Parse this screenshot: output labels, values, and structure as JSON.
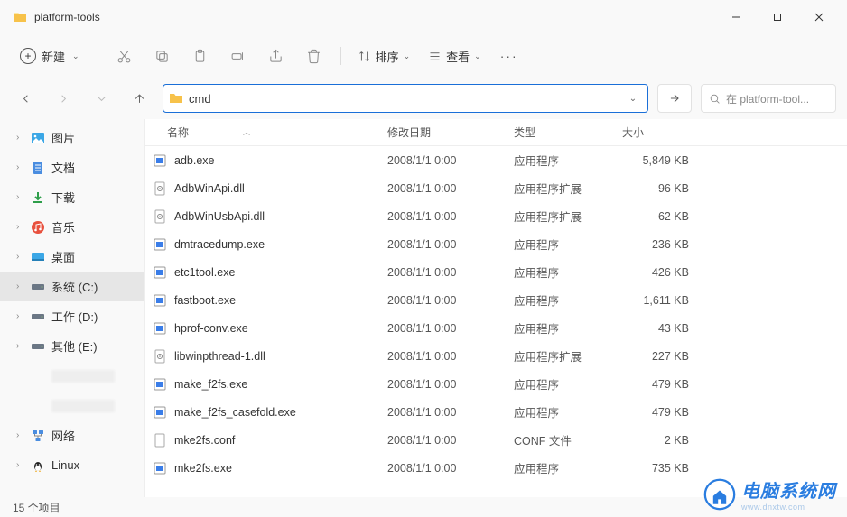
{
  "title": "platform-tools",
  "toolbar": {
    "new_label": "新建",
    "sort_label": "排序",
    "view_label": "查看"
  },
  "address": {
    "value": "cmd"
  },
  "search": {
    "placeholder": "在 platform-tool..."
  },
  "sidebar": {
    "items": [
      {
        "label": "图片",
        "icon": "pictures"
      },
      {
        "label": "文档",
        "icon": "docs"
      },
      {
        "label": "下载",
        "icon": "downloads"
      },
      {
        "label": "音乐",
        "icon": "music"
      },
      {
        "label": "桌面",
        "icon": "desktop"
      },
      {
        "label": "系统 (C:)",
        "icon": "drive",
        "selected": true
      },
      {
        "label": "工作 (D:)",
        "icon": "drive"
      },
      {
        "label": "其他 (E:)",
        "icon": "drive"
      },
      {
        "label": "网络",
        "icon": "network"
      },
      {
        "label": "Linux",
        "icon": "linux"
      }
    ]
  },
  "columns": {
    "name": "名称",
    "date": "修改日期",
    "type": "类型",
    "size": "大小"
  },
  "files": [
    {
      "name": "adb.exe",
      "date": "2008/1/1 0:00",
      "type": "应用程序",
      "size": "5,849 KB",
      "icon": "exe"
    },
    {
      "name": "AdbWinApi.dll",
      "date": "2008/1/1 0:00",
      "type": "应用程序扩展",
      "size": "96 KB",
      "icon": "dll"
    },
    {
      "name": "AdbWinUsbApi.dll",
      "date": "2008/1/1 0:00",
      "type": "应用程序扩展",
      "size": "62 KB",
      "icon": "dll"
    },
    {
      "name": "dmtracedump.exe",
      "date": "2008/1/1 0:00",
      "type": "应用程序",
      "size": "236 KB",
      "icon": "exe"
    },
    {
      "name": "etc1tool.exe",
      "date": "2008/1/1 0:00",
      "type": "应用程序",
      "size": "426 KB",
      "icon": "exe"
    },
    {
      "name": "fastboot.exe",
      "date": "2008/1/1 0:00",
      "type": "应用程序",
      "size": "1,611 KB",
      "icon": "exe"
    },
    {
      "name": "hprof-conv.exe",
      "date": "2008/1/1 0:00",
      "type": "应用程序",
      "size": "43 KB",
      "icon": "exe"
    },
    {
      "name": "libwinpthread-1.dll",
      "date": "2008/1/1 0:00",
      "type": "应用程序扩展",
      "size": "227 KB",
      "icon": "dll"
    },
    {
      "name": "make_f2fs.exe",
      "date": "2008/1/1 0:00",
      "type": "应用程序",
      "size": "479 KB",
      "icon": "exe"
    },
    {
      "name": "make_f2fs_casefold.exe",
      "date": "2008/1/1 0:00",
      "type": "应用程序",
      "size": "479 KB",
      "icon": "exe"
    },
    {
      "name": "mke2fs.conf",
      "date": "2008/1/1 0:00",
      "type": "CONF 文件",
      "size": "2 KB",
      "icon": "conf"
    },
    {
      "name": "mke2fs.exe",
      "date": "2008/1/1 0:00",
      "type": "应用程序",
      "size": "735 KB",
      "icon": "exe"
    }
  ],
  "status": "15 个项目",
  "watermark": {
    "main": "电脑系统网",
    "sub": "www.dnxtw.com"
  }
}
